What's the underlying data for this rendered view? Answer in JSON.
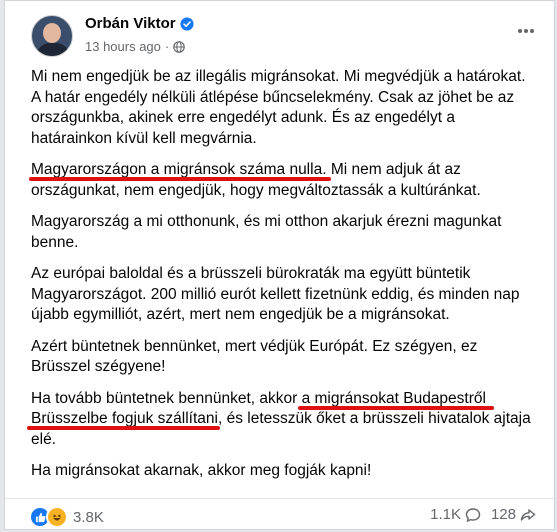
{
  "post": {
    "author": "Orbán Viktor",
    "time": "13 hours ago",
    "separator": "·",
    "paragraphs": [
      "Mi nem engedjük be az illegális migránsokat. Mi megvédjük a határokat. A határ engedély nélküli átlépése bűncselekmény. Csak az jöhet be az országunkba, akinek erre engedélyt adunk. És az engedélyt a határainkon kívül kell megvárnia.",
      "Mi nem adjuk át az országunkat, nem engedjük, hogy megváltoztassák a kultúránkat.",
      "Magyarország a mi otthonunk, és mi otthon akarjuk érezni magunkat benne.",
      "Az európai baloldal és a brüsszeli bürokraták ma együtt büntetik Magyarországot. 200 millió eurót kellett fizetnünk eddig, és minden nap újabb egymilliót, azért, mert nem engedjük be a migránsokat.",
      "Azért büntetnek bennünket, mert védjük Európát. Ez szégyen, ez Brüsszel szégyene!",
      "Ha tovább büntetnek bennünket, akkor ",
      "Ha migránsokat akarnak, akkor meg fogják kapni!"
    ],
    "highlight_1": "Magyarországon a migránsok száma nulla.",
    "highlight_2a": "a migránsokat Budapestről",
    "highlight_2b": "Brüsszelbe fogjuk szállítani",
    "p6_end": ", és letesszük őket a brüsszeli hivatalok ajtaja elé."
  },
  "footer": {
    "reactions_count": "3.8K",
    "comments_count": "1.1K",
    "shares_count": "128"
  },
  "colors": {
    "highlight": "#e01010",
    "like": "#1877f2",
    "haha": "#f7b125"
  }
}
